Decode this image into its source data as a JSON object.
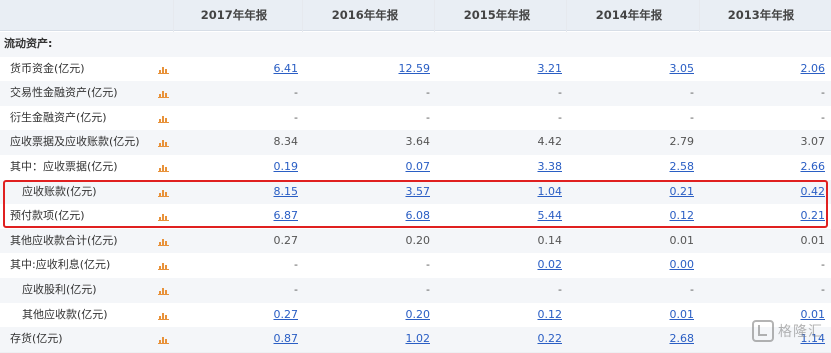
{
  "columns": [
    "2017年年报",
    "2016年年报",
    "2015年年报",
    "2014年年报",
    "2013年年报"
  ],
  "rows": [
    {
      "label": "流动资产:",
      "section": true,
      "icon": false,
      "values": [
        "",
        "",
        "",
        "",
        ""
      ],
      "links": [
        false,
        false,
        false,
        false,
        false
      ]
    },
    {
      "label": "货币资金(亿元)",
      "indent": 1,
      "icon": true,
      "values": [
        "6.41",
        "12.59",
        "3.21",
        "3.05",
        "2.06"
      ],
      "links": [
        true,
        true,
        true,
        true,
        true
      ]
    },
    {
      "label": "交易性金融资产(亿元)",
      "indent": 1,
      "icon": true,
      "values": [
        "-",
        "-",
        "-",
        "-",
        "-"
      ],
      "links": [
        false,
        false,
        false,
        false,
        false
      ]
    },
    {
      "label": "衍生金融资产(亿元)",
      "indent": 1,
      "icon": true,
      "values": [
        "-",
        "-",
        "-",
        "-",
        "-"
      ],
      "links": [
        false,
        false,
        false,
        false,
        false
      ]
    },
    {
      "label": "应收票据及应收账款(亿元)",
      "indent": 1,
      "icon": true,
      "values": [
        "8.34",
        "3.64",
        "4.42",
        "2.79",
        "3.07"
      ],
      "links": [
        false,
        false,
        false,
        false,
        false
      ]
    },
    {
      "label": "其中：应收票据(亿元)",
      "indent": 1,
      "icon": true,
      "values": [
        "0.19",
        "0.07",
        "3.38",
        "2.58",
        "2.66"
      ],
      "links": [
        true,
        true,
        true,
        true,
        true
      ]
    },
    {
      "label": "应收账款(亿元)",
      "indent": 2,
      "icon": true,
      "values": [
        "8.15",
        "3.57",
        "1.04",
        "0.21",
        "0.42"
      ],
      "links": [
        true,
        true,
        true,
        true,
        true
      ]
    },
    {
      "label": "预付款项(亿元)",
      "indent": 1,
      "icon": true,
      "values": [
        "6.87",
        "6.08",
        "5.44",
        "0.12",
        "0.21"
      ],
      "links": [
        true,
        true,
        true,
        true,
        true
      ]
    },
    {
      "label": "其他应收款合计(亿元)",
      "indent": 1,
      "icon": true,
      "values": [
        "0.27",
        "0.20",
        "0.14",
        "0.01",
        "0.01"
      ],
      "links": [
        false,
        false,
        false,
        false,
        false
      ]
    },
    {
      "label": "其中:应收利息(亿元)",
      "indent": 1,
      "icon": true,
      "values": [
        "-",
        "-",
        "0.02",
        "0.00",
        "-"
      ],
      "links": [
        false,
        false,
        true,
        true,
        false
      ]
    },
    {
      "label": "应收股利(亿元)",
      "indent": 2,
      "icon": true,
      "values": [
        "-",
        "-",
        "-",
        "-",
        "-"
      ],
      "links": [
        false,
        false,
        false,
        false,
        false
      ]
    },
    {
      "label": "其他应收款(亿元)",
      "indent": 2,
      "icon": true,
      "values": [
        "0.27",
        "0.20",
        "0.12",
        "0.01",
        "0.01"
      ],
      "links": [
        true,
        true,
        true,
        true,
        true
      ]
    },
    {
      "label": "存货(亿元)",
      "indent": 1,
      "icon": true,
      "values": [
        "0.87",
        "1.02",
        "0.22",
        "2.68",
        "1.14"
      ],
      "links": [
        true,
        true,
        true,
        true,
        true
      ]
    }
  ],
  "highlight_rows": [
    6,
    7
  ],
  "watermark": "格隆汇",
  "colors": {
    "header_bg": "#e9eef4",
    "link": "#2a5ec4",
    "highlight": "#e02020",
    "icon": "#e8923a"
  }
}
